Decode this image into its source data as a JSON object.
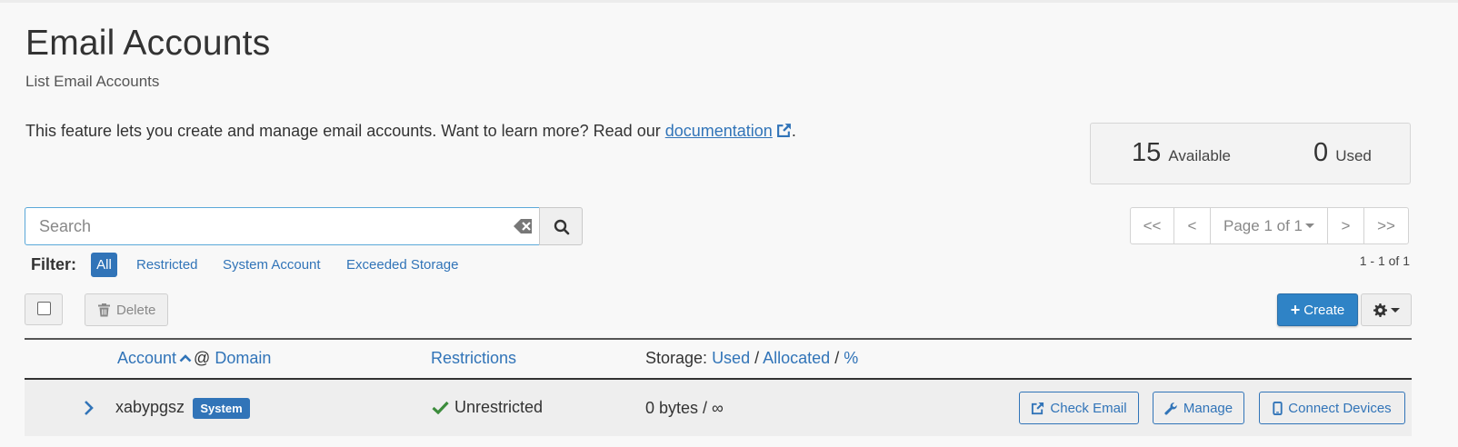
{
  "page": {
    "title": "Email Accounts",
    "subtitle": "List Email Accounts",
    "intro_text": "This feature lets you create and manage email accounts. Want to learn more? Read our ",
    "intro_link": "documentation",
    "intro_end": "."
  },
  "stats": {
    "available_count": "15",
    "available_label": "Available",
    "used_count": "0",
    "used_label": "Used"
  },
  "search": {
    "placeholder": "Search",
    "value": ""
  },
  "pagination": {
    "first": "<<",
    "prev": "<",
    "page_label": "Page 1 of 1",
    "next": ">",
    "last": ">>",
    "range": "1 - 1 of 1"
  },
  "filter": {
    "label": "Filter:",
    "options": [
      "All",
      "Restricted",
      "System Account",
      "Exceeded Storage"
    ],
    "selected": "All"
  },
  "toolbar": {
    "delete_label": "Delete",
    "create_label": "Create"
  },
  "table": {
    "headers": {
      "account": "Account",
      "at": "@",
      "domain": "Domain",
      "restrictions": "Restrictions",
      "storage_prefix": "Storage:",
      "used": "Used",
      "sep1": "/",
      "allocated": "Allocated",
      "sep2": "/",
      "percent": "%"
    },
    "rows": [
      {
        "account": "xabypgsz",
        "badge": "System",
        "restriction": "Unrestricted",
        "storage": "0 bytes / ∞",
        "actions": [
          "Check Email",
          "Manage",
          "Connect Devices"
        ]
      }
    ]
  },
  "colors": {
    "accent": "#3174b8",
    "create_button": "#2f83c6",
    "success_check": "#3c8c3c",
    "background": "#f8f8f8"
  },
  "icons": [
    "external-link-icon",
    "clear-search-icon",
    "search-icon",
    "trash-icon",
    "plus-icon",
    "gear-icon",
    "caret-down-icon",
    "chevron-up-icon",
    "chevron-right-icon",
    "check-icon",
    "wrench-icon",
    "mobile-icon"
  ]
}
